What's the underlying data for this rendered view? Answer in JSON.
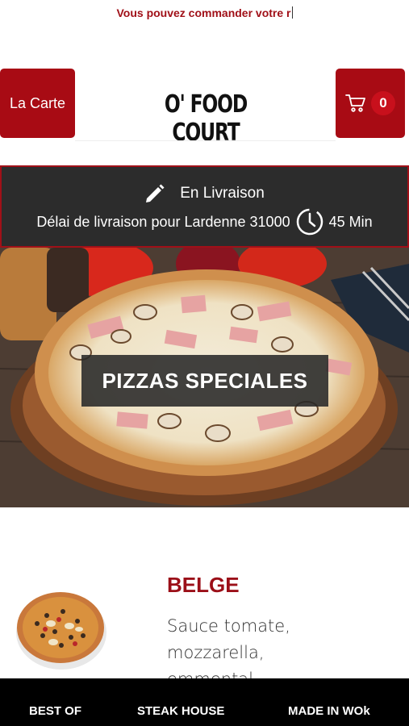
{
  "announcement": "Vous pouvez commander votre r",
  "header": {
    "menu_label": "La Carte",
    "logo_text": "O' FOOD COURT",
    "cart_count": "0",
    "cart_icon": "cart-icon"
  },
  "delivery": {
    "mode_icon": "pencil-icon",
    "mode_label": "En Livraison",
    "delay_text": "Délai de livraison pour Lardenne 31000",
    "clock_icon": "clock-icon",
    "delay_value": "45 Min"
  },
  "category": {
    "title": "PIZZAS SPECIALES"
  },
  "product": {
    "name": "BELGE",
    "description": "Sauce tomate, mozzarella, emmental,"
  },
  "bottom_nav": {
    "items": [
      {
        "label": "BEST OF"
      },
      {
        "label": "STEAK HOUSE"
      },
      {
        "label": "MADE IN WOk"
      }
    ]
  },
  "colors": {
    "brand_red": "#a80b14",
    "dark_bar": "#2c2c2c",
    "nav_bg": "#000000"
  }
}
